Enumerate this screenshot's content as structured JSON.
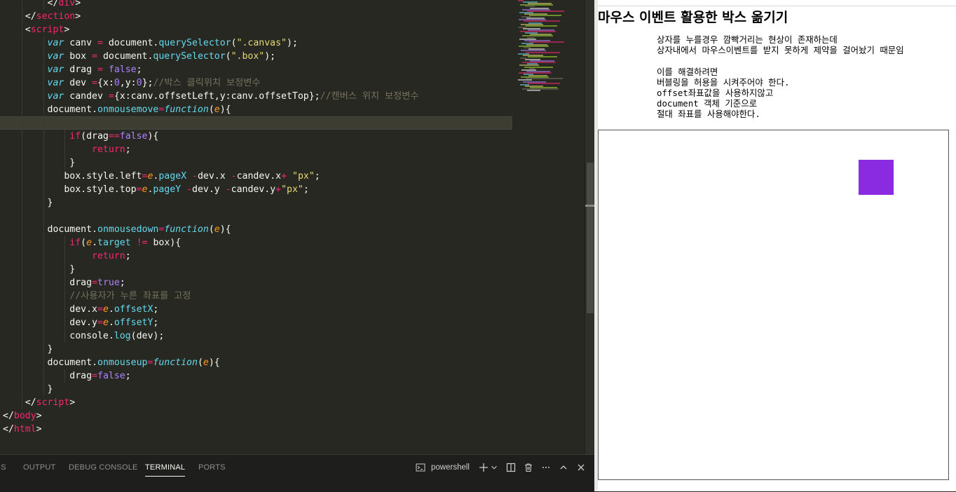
{
  "editor": {
    "lines": [
      [
        {
          "t": "        ",
          "c": ""
        },
        {
          "t": "</",
          "c": "t-obj"
        },
        {
          "t": "div",
          "c": "t-tag"
        },
        {
          "t": ">",
          "c": "t-obj"
        }
      ],
      [
        {
          "t": "    ",
          "c": ""
        },
        {
          "t": "</",
          "c": "t-obj"
        },
        {
          "t": "section",
          "c": "t-tag"
        },
        {
          "t": ">",
          "c": "t-obj"
        }
      ],
      [
        {
          "t": "    ",
          "c": ""
        },
        {
          "t": "<",
          "c": "t-obj"
        },
        {
          "t": "script",
          "c": "t-tag"
        },
        {
          "t": ">",
          "c": "t-obj"
        }
      ],
      [
        {
          "t": "        ",
          "c": ""
        },
        {
          "t": "var",
          "c": "t-kw"
        },
        {
          "t": " canv ",
          "c": ""
        },
        {
          "t": "=",
          "c": "t-op"
        },
        {
          "t": " document.",
          "c": ""
        },
        {
          "t": "querySelector",
          "c": "t-fn"
        },
        {
          "t": "(",
          "c": ""
        },
        {
          "t": "\".canvas\"",
          "c": "t-str"
        },
        {
          "t": ");",
          "c": ""
        }
      ],
      [
        {
          "t": "        ",
          "c": ""
        },
        {
          "t": "var",
          "c": "t-kw"
        },
        {
          "t": " box ",
          "c": ""
        },
        {
          "t": "=",
          "c": "t-op"
        },
        {
          "t": " document.",
          "c": ""
        },
        {
          "t": "querySelector",
          "c": "t-fn"
        },
        {
          "t": "(",
          "c": ""
        },
        {
          "t": "\".box\"",
          "c": "t-str"
        },
        {
          "t": ");",
          "c": ""
        }
      ],
      [
        {
          "t": "        ",
          "c": ""
        },
        {
          "t": "var",
          "c": "t-kw"
        },
        {
          "t": " drag ",
          "c": ""
        },
        {
          "t": "=",
          "c": "t-op"
        },
        {
          "t": " ",
          "c": ""
        },
        {
          "t": "false",
          "c": "t-bool"
        },
        {
          "t": ";",
          "c": ""
        }
      ],
      [
        {
          "t": "        ",
          "c": ""
        },
        {
          "t": "var",
          "c": "t-kw"
        },
        {
          "t": " dev ",
          "c": ""
        },
        {
          "t": "=",
          "c": "t-op"
        },
        {
          "t": "{x:",
          "c": ""
        },
        {
          "t": "0",
          "c": "t-num"
        },
        {
          "t": ",y:",
          "c": ""
        },
        {
          "t": "0",
          "c": "t-num"
        },
        {
          "t": "};",
          "c": ""
        },
        {
          "t": "//박스 클릭위치 보정변수",
          "c": "t-com"
        }
      ],
      [
        {
          "t": "        ",
          "c": ""
        },
        {
          "t": "var",
          "c": "t-kw"
        },
        {
          "t": " candev ",
          "c": ""
        },
        {
          "t": "=",
          "c": "t-op"
        },
        {
          "t": "{x:canv.offsetLeft,y:canv.offsetTop};",
          "c": ""
        },
        {
          "t": "//캔버스 위치 보정변수",
          "c": "t-com"
        }
      ],
      [
        {
          "t": "        ",
          "c": ""
        },
        {
          "t": "document.",
          "c": ""
        },
        {
          "t": "onmousemove",
          "c": "t-fn"
        },
        {
          "t": "=",
          "c": "t-op"
        },
        {
          "t": "function",
          "c": "t-kw"
        },
        {
          "t": "(",
          "c": ""
        },
        {
          "t": "e",
          "c": "t-prm"
        },
        {
          "t": "){",
          "c": ""
        }
      ],
      [
        {
          "t": "",
          "c": ""
        }
      ],
      [
        {
          "t": "            ",
          "c": ""
        },
        {
          "t": "if",
          "c": "t-tag"
        },
        {
          "t": "(drag",
          "c": ""
        },
        {
          "t": "==",
          "c": "t-op"
        },
        {
          "t": "false",
          "c": "t-bool"
        },
        {
          "t": "){",
          "c": ""
        }
      ],
      [
        {
          "t": "                ",
          "c": ""
        },
        {
          "t": "return",
          "c": "t-tag"
        },
        {
          "t": ";",
          "c": ""
        }
      ],
      [
        {
          "t": "            ",
          "c": ""
        },
        {
          "t": "}",
          "c": ""
        }
      ],
      [
        {
          "t": "           box.style.left",
          "c": ""
        },
        {
          "t": "=",
          "c": "t-op"
        },
        {
          "t": "e",
          "c": "t-prm"
        },
        {
          "t": ".",
          "c": ""
        },
        {
          "t": "pageX",
          "c": "t-fn"
        },
        {
          "t": " ",
          "c": ""
        },
        {
          "t": "-",
          "c": "t-op"
        },
        {
          "t": "dev.x ",
          "c": ""
        },
        {
          "t": "-",
          "c": "t-op"
        },
        {
          "t": "candev.x",
          "c": ""
        },
        {
          "t": "+",
          "c": "t-op"
        },
        {
          "t": " ",
          "c": ""
        },
        {
          "t": "\"px\"",
          "c": "t-str"
        },
        {
          "t": ";",
          "c": ""
        }
      ],
      [
        {
          "t": "           box.style.top",
          "c": ""
        },
        {
          "t": "=",
          "c": "t-op"
        },
        {
          "t": "e",
          "c": "t-prm"
        },
        {
          "t": ".",
          "c": ""
        },
        {
          "t": "pageY",
          "c": "t-fn"
        },
        {
          "t": " ",
          "c": ""
        },
        {
          "t": "-",
          "c": "t-op"
        },
        {
          "t": "dev.y ",
          "c": ""
        },
        {
          "t": "-",
          "c": "t-op"
        },
        {
          "t": "candev.y",
          "c": ""
        },
        {
          "t": "+",
          "c": "t-op"
        },
        {
          "t": "\"px\"",
          "c": "t-str"
        },
        {
          "t": ";",
          "c": ""
        }
      ],
      [
        {
          "t": "        ",
          "c": ""
        },
        {
          "t": "}",
          "c": ""
        }
      ],
      [
        {
          "t": "",
          "c": ""
        }
      ],
      [
        {
          "t": "        ",
          "c": ""
        },
        {
          "t": "document.",
          "c": ""
        },
        {
          "t": "onmousedown",
          "c": "t-fn"
        },
        {
          "t": "=",
          "c": "t-op"
        },
        {
          "t": "function",
          "c": "t-kw"
        },
        {
          "t": "(",
          "c": ""
        },
        {
          "t": "e",
          "c": "t-prm"
        },
        {
          "t": "){",
          "c": ""
        }
      ],
      [
        {
          "t": "            ",
          "c": ""
        },
        {
          "t": "if",
          "c": "t-tag"
        },
        {
          "t": "(",
          "c": ""
        },
        {
          "t": "e",
          "c": "t-prm"
        },
        {
          "t": ".",
          "c": ""
        },
        {
          "t": "target",
          "c": "t-fn"
        },
        {
          "t": " ",
          "c": ""
        },
        {
          "t": "!=",
          "c": "t-op"
        },
        {
          "t": " box){",
          "c": ""
        }
      ],
      [
        {
          "t": "                ",
          "c": ""
        },
        {
          "t": "return",
          "c": "t-tag"
        },
        {
          "t": ";",
          "c": ""
        }
      ],
      [
        {
          "t": "            ",
          "c": ""
        },
        {
          "t": "}",
          "c": ""
        }
      ],
      [
        {
          "t": "            drag",
          "c": ""
        },
        {
          "t": "=",
          "c": "t-op"
        },
        {
          "t": "true",
          "c": "t-bool"
        },
        {
          "t": ";",
          "c": ""
        }
      ],
      [
        {
          "t": "            ",
          "c": ""
        },
        {
          "t": "//사용자가 누른 좌표를 고정",
          "c": "t-com"
        }
      ],
      [
        {
          "t": "            dev.x",
          "c": ""
        },
        {
          "t": "=",
          "c": "t-op"
        },
        {
          "t": "e",
          "c": "t-prm"
        },
        {
          "t": ".",
          "c": ""
        },
        {
          "t": "offsetX",
          "c": "t-fn"
        },
        {
          "t": ";",
          "c": ""
        }
      ],
      [
        {
          "t": "            dev.y",
          "c": ""
        },
        {
          "t": "=",
          "c": "t-op"
        },
        {
          "t": "e",
          "c": "t-prm"
        },
        {
          "t": ".",
          "c": ""
        },
        {
          "t": "offsetY",
          "c": "t-fn"
        },
        {
          "t": ";",
          "c": ""
        }
      ],
      [
        {
          "t": "            console.",
          "c": ""
        },
        {
          "t": "log",
          "c": "t-fn"
        },
        {
          "t": "(dev);",
          "c": ""
        }
      ],
      [
        {
          "t": "        ",
          "c": ""
        },
        {
          "t": "}",
          "c": ""
        }
      ],
      [
        {
          "t": "        ",
          "c": ""
        },
        {
          "t": "document.",
          "c": ""
        },
        {
          "t": "onmouseup",
          "c": "t-fn"
        },
        {
          "t": "=",
          "c": "t-op"
        },
        {
          "t": "function",
          "c": "t-kw"
        },
        {
          "t": "(",
          "c": ""
        },
        {
          "t": "e",
          "c": "t-prm"
        },
        {
          "t": "){",
          "c": ""
        }
      ],
      [
        {
          "t": "            drag",
          "c": ""
        },
        {
          "t": "=",
          "c": "t-op"
        },
        {
          "t": "false",
          "c": "t-bool"
        },
        {
          "t": ";",
          "c": ""
        }
      ],
      [
        {
          "t": "        ",
          "c": ""
        },
        {
          "t": "}",
          "c": ""
        }
      ],
      [
        {
          "t": "    ",
          "c": ""
        },
        {
          "t": "</",
          "c": "t-obj"
        },
        {
          "t": "script",
          "c": "t-tag"
        },
        {
          "t": ">",
          "c": "t-obj"
        }
      ],
      [
        {
          "t": "</",
          "c": "t-obj"
        },
        {
          "t": "body",
          "c": "t-tag"
        },
        {
          "t": ">",
          "c": "t-obj"
        }
      ],
      [
        {
          "t": "</",
          "c": "t-obj"
        },
        {
          "t": "html",
          "c": "t-tag"
        },
        {
          "t": ">",
          "c": "t-obj"
        }
      ]
    ],
    "current_line": 9
  },
  "panel": {
    "tabs": [
      {
        "label": "IS",
        "active": false
      },
      {
        "label": "OUTPUT",
        "active": false
      },
      {
        "label": "DEBUG CONSOLE",
        "active": false
      },
      {
        "label": "TERMINAL",
        "active": true
      },
      {
        "label": "PORTS",
        "active": false
      }
    ],
    "terminal_profile": "powershell",
    "icons": [
      "terminal-icon",
      "plus-icon",
      "chevron-down-icon",
      "split-icon",
      "trash-icon",
      "ellipsis-icon",
      "chevron-up-icon",
      "close-icon"
    ]
  },
  "browser": {
    "title": "마우스 이벤트 활용한 박스 옮기기",
    "description_lines": [
      "상자를 누를경우 깜빡거리는 현상이 존재하는데",
      "상자내에서 마우스이벤트를 받지 못하게 제약을 걸어놨기 때문임",
      "",
      "이를 해결하려면",
      "버블링을 허용을 시켜주어야 한다.",
      "offset좌표값을 사용하지않고",
      "document 객체 기준으로",
      "절대 좌표를 사용해야한다."
    ],
    "box_color": "#8a2be2"
  },
  "colors": {
    "editor_bg": "#272822",
    "panel_bg": "#1e1f1c",
    "browser_bg": "#ffffff"
  }
}
